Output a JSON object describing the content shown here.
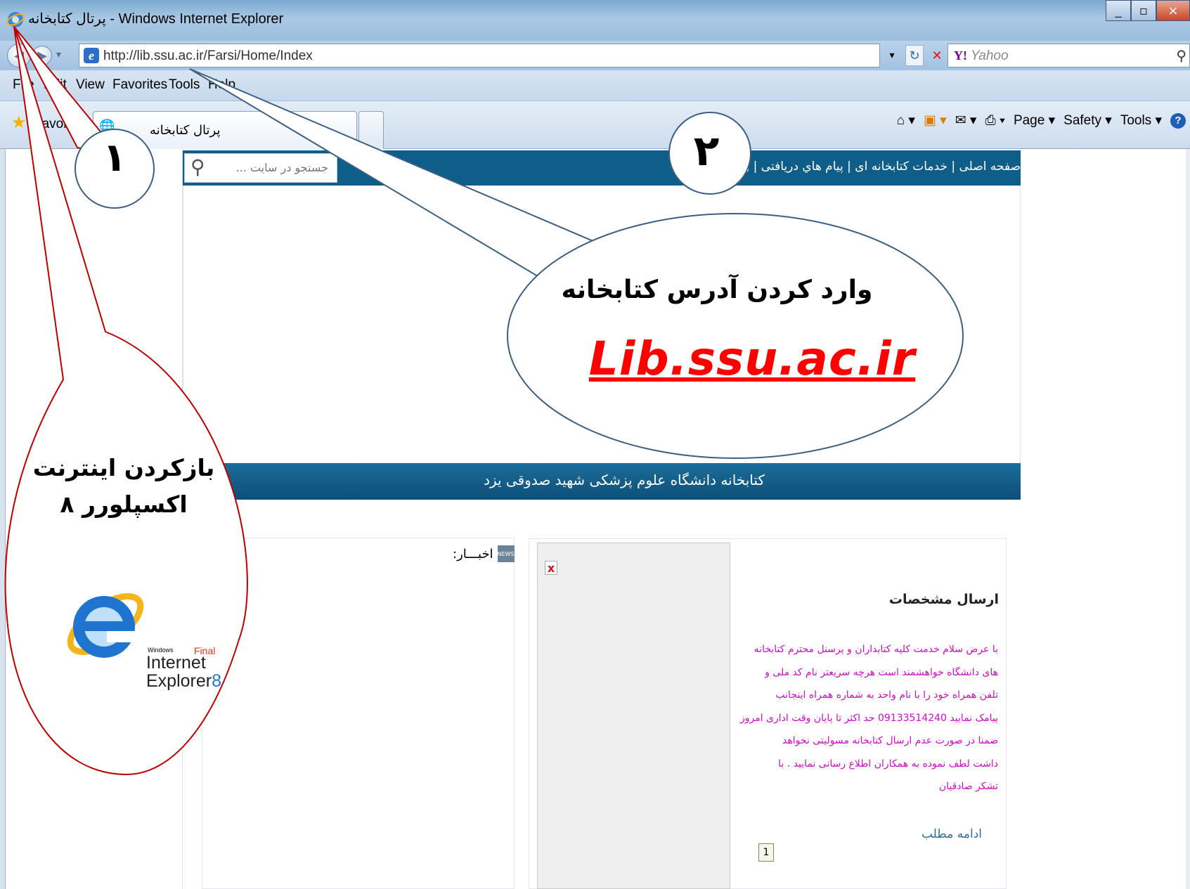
{
  "window": {
    "title": "پرتال کتابخانه - Windows Internet Explorer",
    "controls": [
      "_",
      "▫",
      "×"
    ]
  },
  "address_bar": {
    "url": "http://lib.ssu.ac.ir/Farsi/Home/Index",
    "search_placeholder": "Yahoo"
  },
  "menu": [
    "File",
    "Edit",
    "View",
    "Favorites",
    "Tools",
    "Help"
  ],
  "favorites_label": "Favorites",
  "tab": {
    "title": "پرتال کتابخانه"
  },
  "command_bar": [
    "Page ▾",
    "Safety ▾",
    "Tools ▾"
  ],
  "site": {
    "search_placeholder": "جستجو در سایت ...",
    "nav": "صفحه اصلی | خدمات کتابخانه ای | پیام هاي دریافتی | ورود",
    "university_bar": "کتابخانه دانشگاه علوم پزشکی شهید صدوقی یزد",
    "news_title": "اخبـــار:",
    "article": {
      "title": "ارسال مشخصات",
      "body": [
        "با عرض سلام خدمت کلیه کتابداران و پرسنل محترم کتابخانه",
        "های دانشگاه خواهشمند است هرچه سریعتر نام کد ملی و",
        "تلفن همراه خود را با نام واحد به شماره همراه اینجانب",
        "پیامک نمایید 09133514240 حد اکثر تا پایان وقت اداری امروز",
        "ضمنا در صورت عدم ارسال کتابخانه مسولیتی  نخواهد",
        "داشت لطف نموده به همکاران اطلاع رسانی نمایید  .      با",
        "تشکر صادقیان"
      ],
      "more_link": "ادامه مطلب",
      "page": "1"
    }
  },
  "callouts": {
    "one": "۱",
    "two": "۲",
    "enter_address": "وارد کردن آدرس کتابخانه",
    "library_address": "Lib.ssu.ac.ir",
    "open_ie": "بازکردن اینترنت اکسپلورر ۸",
    "ie_logo": {
      "windows": "Windows",
      "final": "Final",
      "name": "Internet",
      "name2": "Explorer",
      "version": "8"
    }
  },
  "colors": {
    "site_header": "#0f5e8a",
    "callout_outline_red": "#c00000",
    "callout_outline_blue": "#3c5f84",
    "address_highlight": "#ff0000",
    "article_text": "#d20cc9"
  }
}
